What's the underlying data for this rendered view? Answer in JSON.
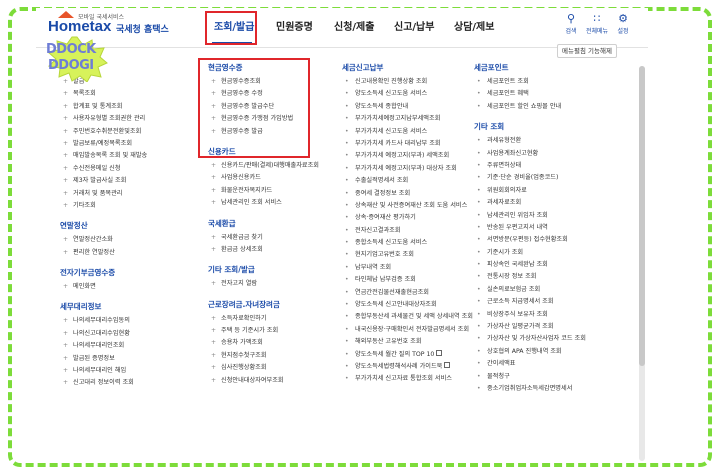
{
  "logo": {
    "brand": "Hometax",
    "tagline": "국세청 홈택스",
    "small": "모바일 국세서비스"
  },
  "nav": [
    "조회/발급",
    "민원증명",
    "신청/제출",
    "신고/납부",
    "상담/제보"
  ],
  "tools": [
    {
      "icon": "search-icon",
      "label": "검색"
    },
    {
      "icon": "grid-menu-icon",
      "label": "전체메뉴"
    },
    {
      "icon": "gear-icon",
      "label": "설정"
    }
  ],
  "sitemap_button": "메뉴펼침 기능해제",
  "sticker": {
    "line1": "DDOCK",
    "line2": "DDOGI"
  },
  "columns": [
    {
      "sections": [
        {
          "title": "세금계산서",
          "items": [
            "발급",
            "목록조회",
            "합계표 및 통계조회",
            "사용자유형별 조회권한 관리",
            "주민번호수취분전환및조회",
            "발급보류/예정목록조회",
            "매입발송목록 조회 및 재발송",
            "수신전용메일 신청",
            "제3자 발급사실 조회",
            "거래처 및 품목관리",
            "기타조회"
          ]
        },
        {
          "title": "연말정산",
          "items": [
            "연말정산간소화",
            "편리한 연말정산"
          ]
        },
        {
          "title": "전자기부금영수증",
          "items": [
            "메인화면"
          ]
        },
        {
          "title": "세무대리정보",
          "items": [
            "나의세무대리수임동의",
            "나의신고대리수임현황",
            "나의세무대리인조회",
            "발급된 증명정보",
            "나의세무대리인 해임",
            "신고대리 정보이력 조회"
          ]
        }
      ]
    },
    {
      "sections": [
        {
          "title": "현금영수증",
          "items": [
            "현금영수증조회",
            "현금영수증 수정",
            "현금영수증 발급수단",
            "현금영수증 가맹점 가입방법",
            "현금영수증 발급"
          ]
        },
        {
          "title": "신용카드",
          "items": [
            "신용카드/판매(결제)대행매출자료조회",
            "사업용신용카드",
            "화물운전자복지카드",
            "납세관리인 조회 서비스"
          ]
        },
        {
          "title": "국세환급",
          "items": [
            "국세환급금 찾기",
            "환급금 상세조회"
          ]
        },
        {
          "title": "기타 조회/발급",
          "items": [
            "전자고지 열람"
          ]
        },
        {
          "title": "근로장려금.자녀장려금",
          "items": [
            "소득자료확인하기",
            "주택 등 기준시가 조회",
            "승용차 가액조회",
            "현지점수첫구조회",
            "심사진행상황조회",
            "신청안내대상자여부조회"
          ]
        }
      ]
    },
    {
      "sections": [
        {
          "title": "세금신고납부",
          "items": [
            "신고내용확인 진행상황 조회",
            "양도소득세 신고도움 서비스",
            "양도소득세 종합안내",
            "부가가치세예정고지납부세액조회",
            "부가가치세 신고도움 서비스",
            "부가가치세 카드사 대리납부 조회",
            "부가가치세 예정고지(부과) 세액조회",
            "부가가치세 예정고지(부과) 대상자 조회",
            "수출실적명세서 조회",
            "중여세 결정정보 조회",
            "상속재산 및 사전증여재산 조회 도움 서비스",
            "상속·증여재산 평가하기",
            "전자신고결과조회",
            "종합소득세 신고도움 서비스",
            "현지기업고유번호 조회",
            "납부내역 조회",
            "타인체납 납부검증 조회",
            "연금간전김물선재출현금조회",
            "양도소득세 신고안내대상자조회",
            "종합부동산세 과세물건 및 세액 상세내역 조회",
            "내국신용장·구매확인서 전자발급명세서 조회",
            "해외부동산 고유번호 조회",
            "양도소득세 월간 질의 TOP 10",
            "양도소득세법령해석사례 가이드북",
            "부가가치세 신고자료 통합조회 서비스"
          ]
        }
      ]
    },
    {
      "sections": [
        {
          "title": "세금포인트",
          "items": [
            "세금포인트 조회",
            "세금포인트 혜택",
            "세금포인트 할인 쇼핑몰 안내"
          ]
        },
        {
          "title": "기타 조회",
          "items": [
            "과세유형전환",
            "사업용계좌신고현황",
            "주류면허상태",
            "기준·단순 경비율(업종코드)",
            "위원회회의자료",
            "과세자료조회",
            "납세관리인 위임자 조회",
            "반송된 우편고지서 내역",
            "서면방문(우편등) 접수현황조회",
            "기준시가 조회",
            "피상속인 국세완납 조회",
            "전통시장 정보 조회",
            "실손의료보험금 조회",
            "근로소득 지급명세서 조회",
            "비상장주식 보유자 조회",
            "가상자산 일평균가격 조회",
            "가상자산 및 가상자산사업자 코드 조회",
            "상호협의 APA 진행내역 조회",
            "간이세액표",
            "물적청구",
            "중소기업취업자소득세감면명세서"
          ]
        }
      ]
    }
  ]
}
